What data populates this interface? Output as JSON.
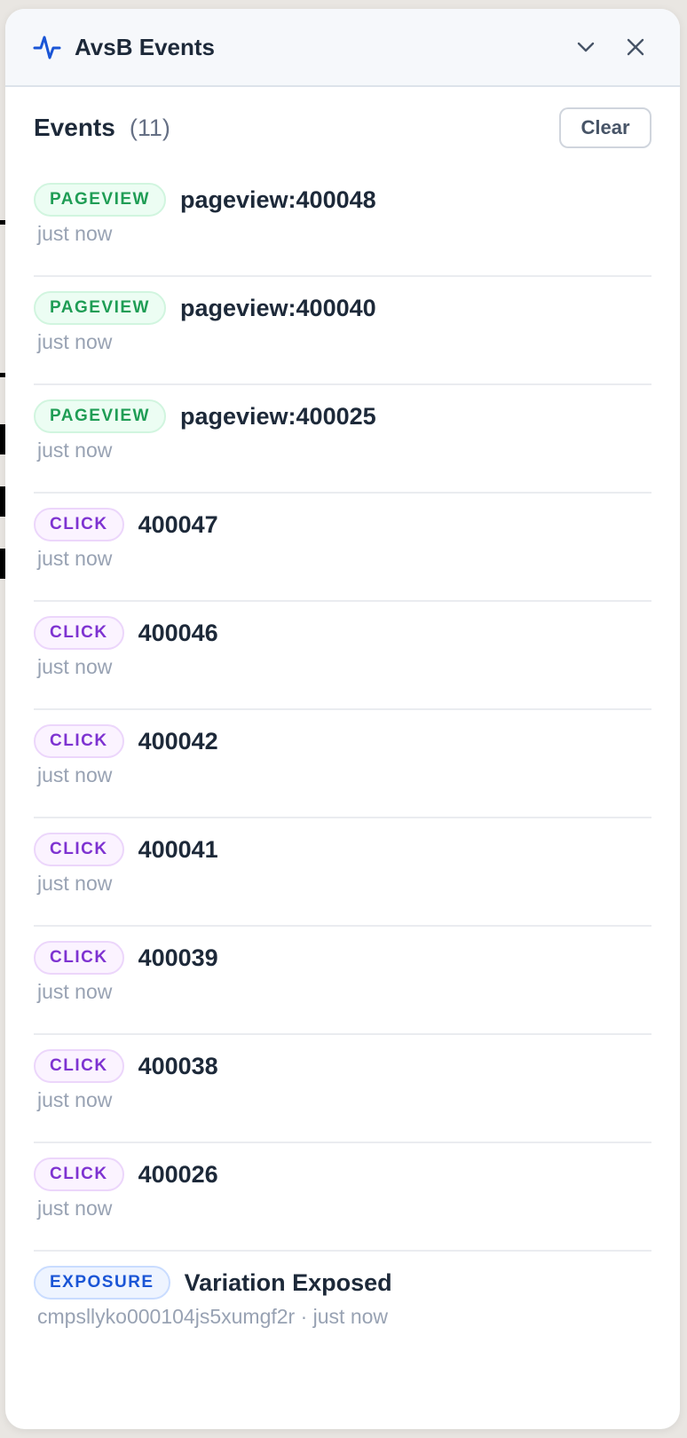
{
  "window": {
    "title": "AvsB Events",
    "icon": "activity-pulse-icon",
    "collapse_icon": "chevron-down-icon",
    "close_icon": "close-icon"
  },
  "events_header": {
    "title": "Events",
    "count": "(11)",
    "clear_label": "Clear"
  },
  "colors": {
    "accent": "#1a55d6",
    "pageview": "#1f9d55",
    "click": "#7e33d1",
    "exposure": "#1a55d6"
  },
  "events": [
    {
      "type": "pageview",
      "badge": "PAGEVIEW",
      "name": "pageview:400048",
      "meta": "just now"
    },
    {
      "type": "pageview",
      "badge": "PAGEVIEW",
      "name": "pageview:400040",
      "meta": "just now"
    },
    {
      "type": "pageview",
      "badge": "PAGEVIEW",
      "name": "pageview:400025",
      "meta": "just now"
    },
    {
      "type": "click",
      "badge": "CLICK",
      "name": "400047",
      "meta": "just now"
    },
    {
      "type": "click",
      "badge": "CLICK",
      "name": "400046",
      "meta": "just now"
    },
    {
      "type": "click",
      "badge": "CLICK",
      "name": "400042",
      "meta": "just now"
    },
    {
      "type": "click",
      "badge": "CLICK",
      "name": "400041",
      "meta": "just now"
    },
    {
      "type": "click",
      "badge": "CLICK",
      "name": "400039",
      "meta": "just now"
    },
    {
      "type": "click",
      "badge": "CLICK",
      "name": "400038",
      "meta": "just now"
    },
    {
      "type": "click",
      "badge": "CLICK",
      "name": "400026",
      "meta": "just now"
    },
    {
      "type": "exposure",
      "badge": "EXPOSURE",
      "name": "Variation Exposed",
      "meta": "cmpsllyko000104js5xumgf2r · just now"
    }
  ]
}
